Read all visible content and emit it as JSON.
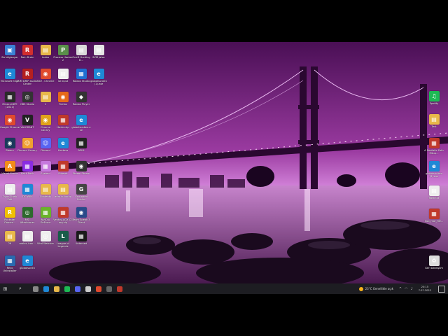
{
  "desktop": {
    "icons": [
      {
        "label": "Bu bilgisayar",
        "color": "#3b82d6",
        "glyph": "▣"
      },
      {
        "label": "Rain Drain",
        "color": "#d12e2e",
        "glyph": "R"
      },
      {
        "label": "inaba",
        "color": "#e8b84a",
        "glyph": "▤"
      },
      {
        "label": "Process Hacker 2",
        "color": "#5a8f4a",
        "glyph": "P"
      },
      {
        "label": "OneD Hunting B...",
        "color": "#d9d9d9",
        "glyph": "▤"
      },
      {
        "label": "SVM Jatoc",
        "color": "#e5e5e5",
        "glyph": "▤"
      },
      {
        "label": "Microsoft Edge",
        "color": "#1e88d6",
        "glyph": "e"
      },
      {
        "label": "RIM DRIP Audio Center",
        "color": "#b52020",
        "glyph": "R"
      },
      {
        "label": "Half - Chrome",
        "color": "#e04a2e",
        "glyph": "◉"
      },
      {
        "label": "lol input",
        "color": "#eeeeee",
        "glyph": "▤"
      },
      {
        "label": "Roblox Studio",
        "color": "#1f6fd1",
        "glyph": "▦"
      },
      {
        "label": "globalsunken (1).exe",
        "color": "#1e88d6",
        "glyph": "e"
      },
      {
        "label": "MinecraftPE (2021)",
        "color": "#2a2a2a",
        "glyph": "▦"
      },
      {
        "label": "OBS Studio",
        "color": "#333333",
        "glyph": "◎"
      },
      {
        "label": "1",
        "color": "#e8b84a",
        "glyph": "▤"
      },
      {
        "label": "Firefox",
        "color": "#e66a1a",
        "glyph": "◉"
      },
      {
        "label": "Roblox Player",
        "color": "#333333",
        "glyph": "◆"
      },
      {
        "label": "Google Chrome",
        "color": "#e04a2e",
        "glyph": "◉"
      },
      {
        "label": "VALORANT",
        "color": "#222222",
        "glyph": "V"
      },
      {
        "label": "Chrome Canary",
        "color": "#e0a21a",
        "glyph": "◉"
      },
      {
        "label": "Hacks.zip",
        "color": "#c0392b",
        "glyph": "▦"
      },
      {
        "label": "globalsunken.exe",
        "color": "#1e88d6",
        "glyph": "e"
      },
      {
        "label": "Steam",
        "color": "#1b3a5c",
        "glyph": "◉"
      },
      {
        "label": "Discord Canary",
        "color": "#f0a030",
        "glyph": "☺"
      },
      {
        "label": "Discord",
        "color": "#5865f2",
        "glyph": "☺"
      },
      {
        "label": "Hackers",
        "color": "#1e88d6",
        "glyph": "e"
      },
      {
        "label": "ASIM",
        "color": "#222222",
        "glyph": "▦"
      },
      {
        "label": "Visual Studio",
        "color": "#f28c1a",
        "glyph": "A"
      },
      {
        "label": "Hack Pack",
        "color": "#8a2be2",
        "glyph": "▦"
      },
      {
        "label": "System",
        "color": "#c678dd",
        "glyph": "▦"
      },
      {
        "label": "Ruleset",
        "color": "#c0392b",
        "glyph": "▦"
      },
      {
        "label": "Steam Steam",
        "color": "#333333",
        "glyph": "◉"
      },
      {
        "label": "Oyun Trash Edit",
        "color": "#eeeeee",
        "glyph": "▤"
      },
      {
        "label": "DC WIN",
        "color": "#1e88d6",
        "glyph": "▦"
      },
      {
        "label": "Contents",
        "color": "#e8b84a",
        "glyph": "▤"
      },
      {
        "label": "adm.bulunup",
        "color": "#e8b84a",
        "glyph": "▤"
      },
      {
        "label": "Grounded Roblox",
        "color": "#444444",
        "glyph": "G"
      },
      {
        "label": "Rockstar Games...",
        "color": "#f0c000",
        "glyph": "R"
      },
      {
        "label": "MSI Afterburner",
        "color": "#2d6a2d",
        "glyph": "◎"
      },
      {
        "label": "NVIDIA GeForce",
        "color": "#6ab42a",
        "glyph": "▦"
      },
      {
        "label": "Ventoy-AGX (2) any.zip",
        "color": "#c0392b",
        "glyph": "▦"
      },
      {
        "label": "Team Speak 3 Client",
        "color": "#2a4a8a",
        "glyph": "◉"
      },
      {
        "label": "26",
        "color": "#e8b84a",
        "glyph": "▤"
      },
      {
        "label": "roblox-icon...",
        "color": "#eeeeee",
        "glyph": "▤"
      },
      {
        "label": "Vital Watcher",
        "color": "#eeeeee",
        "glyph": "◎"
      },
      {
        "label": "League of Legends",
        "color": "#1a5c4a",
        "glyph": "L"
      },
      {
        "label": "Untamed",
        "color": "#1a1a1a",
        "glyph": "▦"
      },
      {
        "label": "Revo Uninstaller",
        "color": "#2a6ab0",
        "glyph": "▦"
      },
      {
        "label": "globalsunkn",
        "color": "#1e88d6",
        "glyph": "e"
      },
      {
        "label": "Spotify",
        "color": "#1db954",
        "glyph": "♫"
      },
      {
        "label": "Test",
        "color": "#e8b84a",
        "glyph": "▤"
      },
      {
        "label": "A Realistic Path Mkup...",
        "color": "#c0392b",
        "glyph": "▦"
      },
      {
        "label": "globalsunken (3).exe",
        "color": "#1e88d6",
        "glyph": "e"
      },
      {
        "label": "flash.txt",
        "color": "#eeeeee",
        "glyph": "▤"
      },
      {
        "label": "hub_mar_file...",
        "color": "#c0392b",
        "glyph": "▦"
      },
      {
        "label": "Geri Dönüşüm",
        "color": "#dddddd",
        "glyph": "♻"
      }
    ]
  },
  "taskbar": {
    "start_label": "⊞",
    "search_label": "⌕",
    "apps": [
      {
        "name": "task-view",
        "color": "#888888"
      },
      {
        "name": "edge",
        "color": "#1e88d6"
      },
      {
        "name": "explorer",
        "color": "#e8b84a"
      },
      {
        "name": "spotify",
        "color": "#1db954"
      },
      {
        "name": "discord",
        "color": "#5865f2"
      },
      {
        "name": "roblox",
        "color": "#cccccc"
      },
      {
        "name": "chrome",
        "color": "#e04a2e"
      },
      {
        "name": "obs",
        "color": "#666666"
      },
      {
        "name": "winrar",
        "color": "#c0392b"
      }
    ],
    "weather_text": "23°C  Genellikle açık",
    "time": "20:15",
    "date": "7.07.2022"
  },
  "colors": {
    "taskbar_bg": "#1d1d22",
    "letterbox": "#000000"
  }
}
